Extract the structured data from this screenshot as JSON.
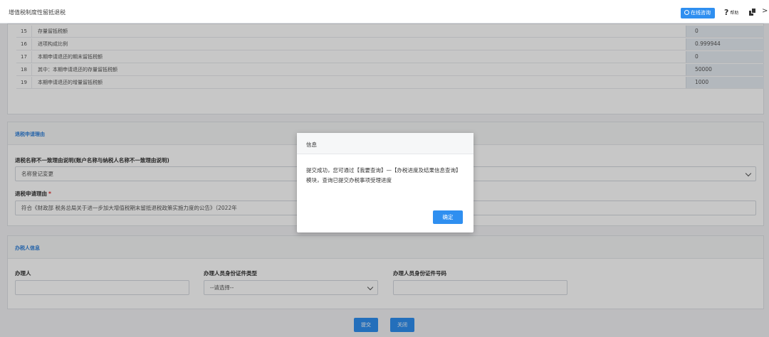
{
  "header": {
    "title": "增值税制度性留抵退税",
    "online_button": "在线咨询",
    "help_label": "帮助",
    "more": ">"
  },
  "table": {
    "rows": [
      {
        "num": "15",
        "name": "存量留抵税额",
        "value": "0"
      },
      {
        "num": "16",
        "name": "进项构成比例",
        "value": "0.999944"
      },
      {
        "num": "17",
        "name": "本期申请退还的期末留抵税额",
        "value": "0"
      },
      {
        "num": "18",
        "name": "其中：本期申请退还的存量留抵税额",
        "value": "50000"
      },
      {
        "num": "19",
        "name": "本期申请退还的增量留抵税额",
        "value": "1000"
      }
    ]
  },
  "reason_section": {
    "title": "退税申请理由",
    "name_mismatch_label": "退税名称不一致理由说明(账户名称与纳税人名称不一致理由说明)",
    "name_mismatch_value": "名称登记変更",
    "reason_label": "退税申请理由",
    "reason_required_mark": "*",
    "reason_value": "符合《财政部 税务总局关于进一步加大增值税期末留抵退税政策实施力度的公告》（2022年"
  },
  "agent_section": {
    "title": "办税人信息",
    "agent_label": "办理人",
    "agent_value": "",
    "id_type_label": "办理人员身份证件类型",
    "id_type_value": "--请选择--",
    "id_number_label": "办理人员身份证件号码",
    "id_number_value": ""
  },
  "footer": {
    "submit": "提交",
    "close": "关闭"
  },
  "modal": {
    "title": "信息",
    "message": "提交成功，您可通过【我要查询】—【办税进度及结果信息查询】模块，查询已提交办税事项受理进度",
    "ok": "确定"
  },
  "colors": {
    "primary": "#2f8ff0",
    "section_title": "#2f7fd8",
    "required": "#e03030"
  }
}
